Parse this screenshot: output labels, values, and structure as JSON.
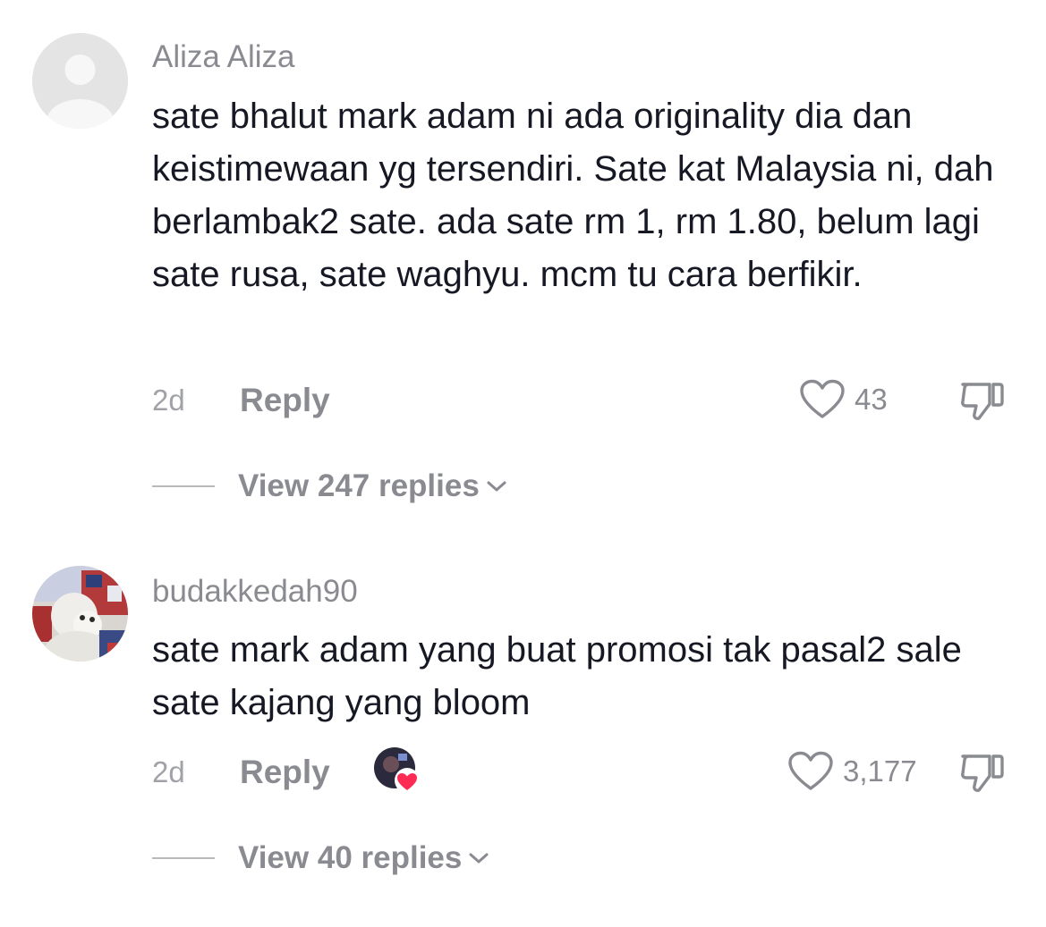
{
  "comments": [
    {
      "username": "Aliza Aliza",
      "text": "sate bhalut mark adam ni ada originality dia dan keistimewaan yg tersendiri. Sate kat Malaysia ni, dah berlambak2 sate. ada sate rm 1, rm 1.80, belum lagi sate rusa, sate waghyu. mcm tu cara berfikir.",
      "time": "2d",
      "reply_label": "Reply",
      "like_count": "43",
      "view_replies": "View 247 replies",
      "avatar": "default-user-icon"
    },
    {
      "username": "budakkedah90",
      "text": "sate mark adam yang buat promosi tak pasal2 sale sate kajang yang bloom",
      "time": "2d",
      "reply_label": "Reply",
      "like_count": "3,177",
      "view_replies": "View 40 replies",
      "avatar": "user-photo-avatar",
      "creator_liked": true
    }
  ],
  "colors": {
    "text": "#161823",
    "muted": "#8a8b91",
    "heart_badge": "#fe2c55"
  }
}
